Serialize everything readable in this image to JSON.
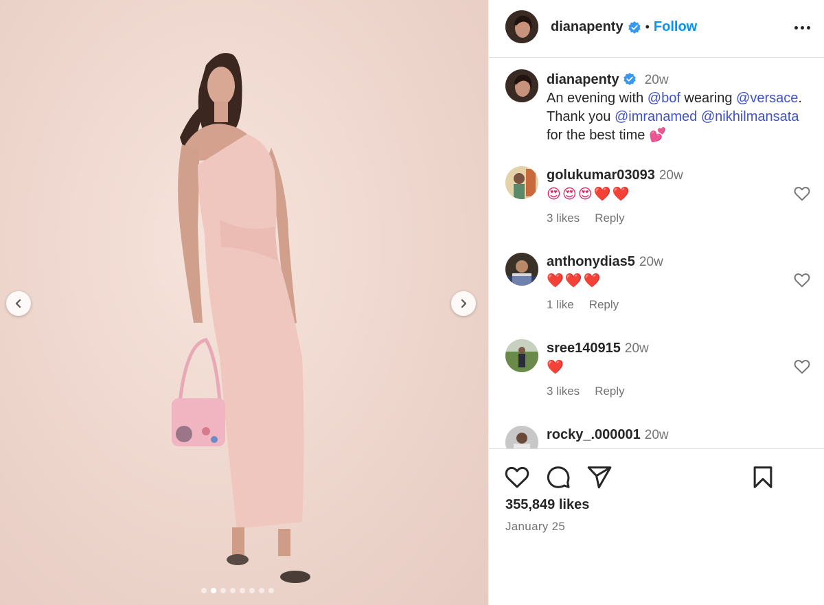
{
  "post": {
    "username": "dianapenty",
    "follow_label": "Follow",
    "separator": "•",
    "likes": "355,849 likes",
    "date": "January 25",
    "media_dots": 8,
    "active_dot": 1
  },
  "caption": {
    "username": "dianapenty",
    "time": "20w",
    "line1_pre": "An evening with ",
    "mention1": "@bof",
    "line1_mid": " wearing ",
    "mention2": "@versace",
    "line1_post": ".",
    "line2_pre": "Thank you ",
    "mention3": "@imranamed",
    "line2_mid": " ",
    "mention4": "@nikhilmansata",
    "line3": "for the best time 💕"
  },
  "comments": [
    {
      "username": "golukumar03093",
      "time": "20w",
      "text": "😍😍😍❤️❤️",
      "likes": "3 likes",
      "reply": "Reply"
    },
    {
      "username": "anthonydias5",
      "time": "20w",
      "text": "❤️❤️❤️",
      "likes": "1 like",
      "reply": "Reply"
    },
    {
      "username": "sree140915",
      "time": "20w",
      "text": "❤️",
      "likes": "3 likes",
      "reply": "Reply"
    },
    {
      "username": "rocky_.000001",
      "time": "20w"
    }
  ],
  "icons": {
    "verified": "verified-badge-icon",
    "more": "more-options-icon",
    "like": "heart-icon",
    "comment": "comment-icon",
    "share": "share-icon",
    "save": "bookmark-icon",
    "prev": "chevron-left-icon",
    "next": "chevron-right-icon"
  },
  "colors": {
    "accent": "#0095f6",
    "mention": "#3f51c8",
    "verified": "#3897f0",
    "dress": "#f0c7bf",
    "background": "#efd8cf"
  }
}
